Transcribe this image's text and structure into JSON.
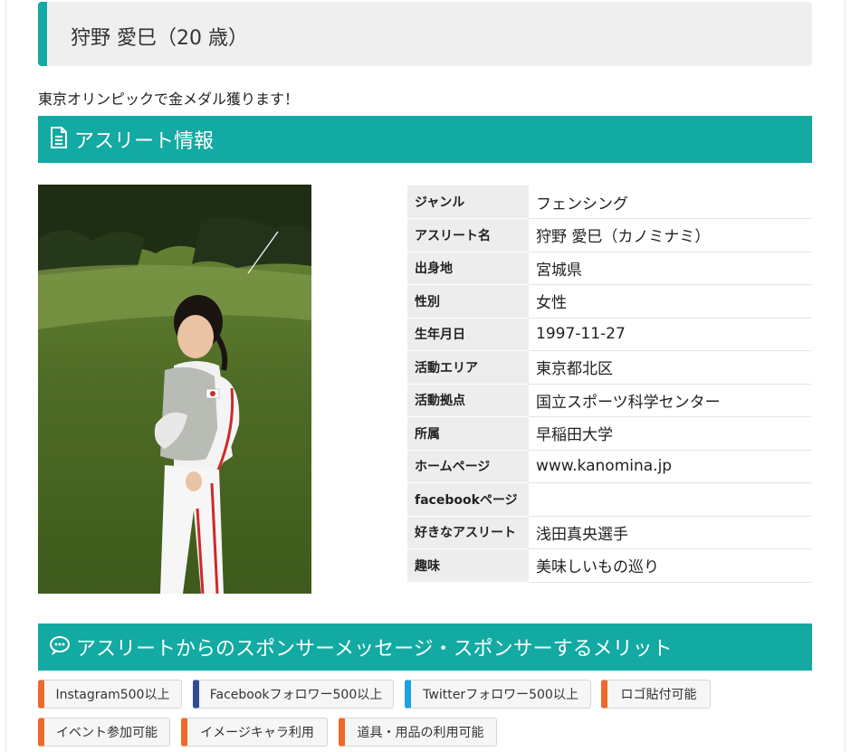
{
  "profile": {
    "name_line": "狩野 愛巳（20 歳）",
    "catchphrase": "東京オリンピックで金メダル獲ります！"
  },
  "sections": {
    "info_title": "アスリート情報",
    "sponsor_title": "アスリートからのスポンサーメッセージ・スポンサーするメリット"
  },
  "info_rows": [
    {
      "label": "ジャンル",
      "value": "フェンシング"
    },
    {
      "label": "アスリート名",
      "value": "狩野 愛巳（カノミナミ）"
    },
    {
      "label": "出身地",
      "value": "宮城県"
    },
    {
      "label": "性別",
      "value": "女性"
    },
    {
      "label": "生年月日",
      "value": "1997-11-27"
    },
    {
      "label": "活動エリア",
      "value": "東京都北区"
    },
    {
      "label": "活動拠点",
      "value": "国立スポーツ科学センター"
    },
    {
      "label": "所属",
      "value": "早稲田大学"
    },
    {
      "label": "ホームページ",
      "value": "www.kanomina.jp"
    },
    {
      "label": "facebookページ",
      "value": ""
    },
    {
      "label": "好きなアスリート",
      "value": "浅田真央選手"
    },
    {
      "label": "趣味",
      "value": "美味しいもの巡り"
    }
  ],
  "tags": [
    {
      "label": "Instagram500以上",
      "color": "#ee6a2c"
    },
    {
      "label": "Facebookフォロワー500以上",
      "color": "#2f4b93"
    },
    {
      "label": "Twitterフォロワー500以上",
      "color": "#1da1e2"
    },
    {
      "label": "ロゴ貼付可能",
      "color": "#ee6a2c"
    },
    {
      "label": "イベント参加可能",
      "color": "#ee6a2c"
    },
    {
      "label": "イメージキャラ利用",
      "color": "#ee6a2c"
    },
    {
      "label": "道具・用品の利用可能",
      "color": "#ee6a2c"
    }
  ],
  "icons": {
    "info": "document-icon",
    "sponsor": "speech-bubble-icon"
  },
  "colors": {
    "accent": "#12aaa2",
    "title_bg": "#efefef"
  }
}
